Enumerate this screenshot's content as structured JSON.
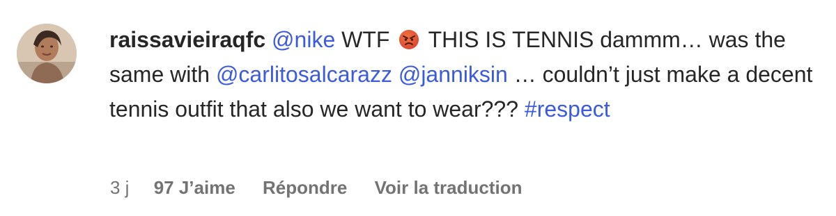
{
  "comment": {
    "username": "raissavieiraqfc",
    "avatar_icon": "profile-photo",
    "segments": {
      "s1_mention": "@nike",
      "s2_text": " WTF ",
      "emoji_icon": "angry-face-emoji",
      "s3_text": " THIS IS TENNIS dammm… was the same with ",
      "s4_mention": "@carlitosalcarazz",
      "s5_text": " ",
      "s6_mention": "@janniksin",
      "s7_text": " … couldn’t just make a decent tennis outfit that also we want to wear??? ",
      "s8_hashtag": "#respect"
    },
    "colors": {
      "link": "#3b5bdb",
      "text": "#262626",
      "meta": "#737373"
    }
  },
  "actions": {
    "time": "3 j",
    "likes": "97 J’aime",
    "reply": "Répondre",
    "translate": "Voir la traduction"
  }
}
